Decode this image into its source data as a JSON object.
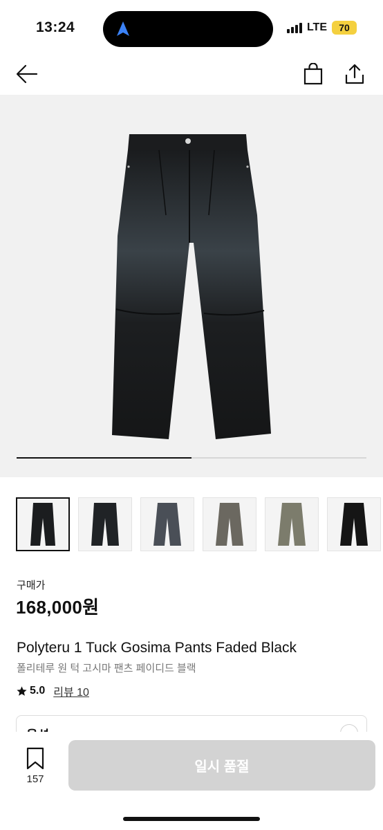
{
  "status_bar": {
    "time": "13:24",
    "network": "LTE",
    "battery": "70"
  },
  "header": {
    "back_icon": "arrow-left-icon",
    "bag_icon": "shopping-bag-icon",
    "share_icon": "share-icon"
  },
  "gallery": {
    "progress": 0.5,
    "thumbnail_count": 6
  },
  "product": {
    "price_label": "구매가",
    "price": "168,000원",
    "title_en": "Polyteru 1 Tuck Gosima Pants Faded Black",
    "title_ko": "폴리테루 원 턱 고시마 팬츠 페이디드 블랙",
    "rating": "5.0",
    "review_text": "리뷰 10"
  },
  "options": {
    "label": "옵션"
  },
  "bottom": {
    "wish_count": "157",
    "button_label": "일시 품절"
  },
  "colors": {
    "sold_out_button": "#d3d3d3",
    "battery": "#f4d03f",
    "island_arrow": "#3b82f6"
  }
}
